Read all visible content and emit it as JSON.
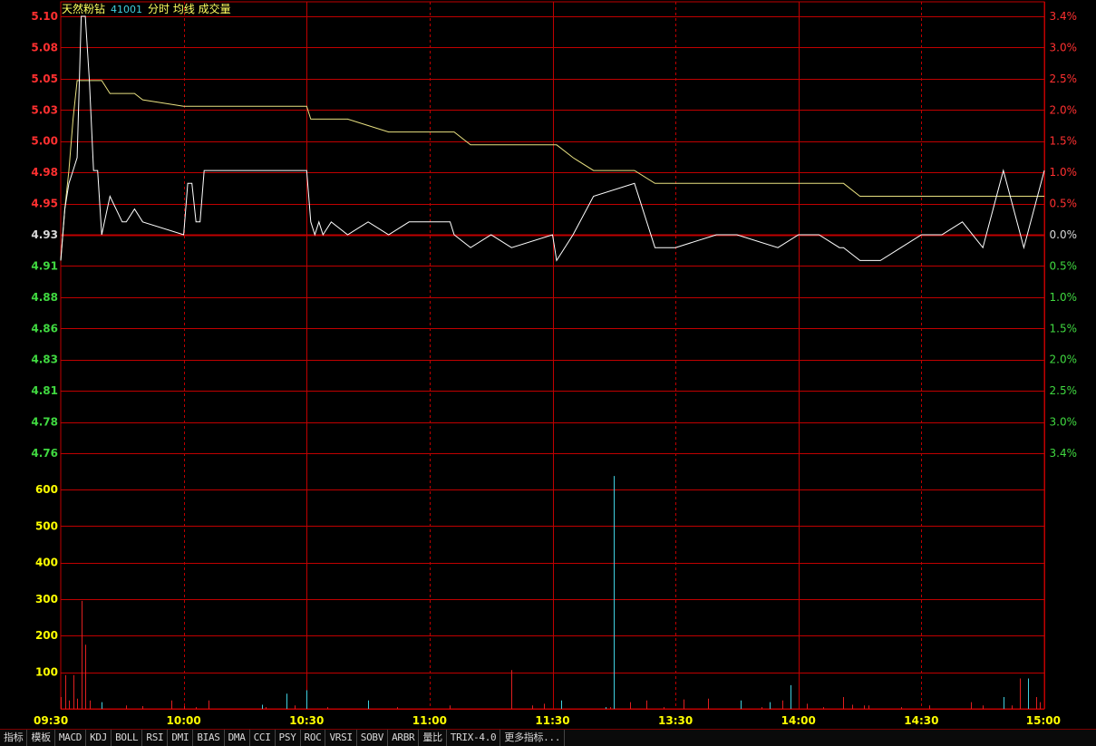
{
  "header": {
    "stock_name": "天然粉钻",
    "stock_code": "41001",
    "indicators": "分时 均线 成交量"
  },
  "colors": {
    "background": "#000000",
    "grid": "#c00000",
    "price_line": "#ffffff",
    "avg_line": "#e8e080",
    "up": "#ff3030",
    "down": "#40d840",
    "neutral_axis": "#ffff00",
    "volume_up": "#e02020",
    "volume_down": "#40d0e0"
  },
  "price_axis": {
    "labels": [
      "5.10",
      "5.08",
      "5.05",
      "5.03",
      "5.00",
      "4.98",
      "4.95",
      "4.93",
      "4.91",
      "4.88",
      "4.86",
      "4.83",
      "4.81",
      "4.78",
      "4.76"
    ],
    "ref_price": 4.93,
    "max": 5.1,
    "min": 4.76
  },
  "pct_axis": {
    "labels": [
      "3.4%",
      "3.0%",
      "2.5%",
      "2.0%",
      "1.5%",
      "1.0%",
      "0.5%",
      "0.0%",
      "0.5%",
      "1.0%",
      "1.5%",
      "2.0%",
      "2.5%",
      "3.0%",
      "3.4%"
    ]
  },
  "volume_axis": {
    "labels": [
      "600",
      "500",
      "400",
      "300",
      "200",
      "100"
    ],
    "max": 690
  },
  "time_axis": {
    "labels": [
      "09:30",
      "10:00",
      "10:30",
      "11:00",
      "11:30",
      "13:30",
      "14:00",
      "14:30",
      "15:00"
    ]
  },
  "chart_data": {
    "type": "line",
    "x": [
      0,
      1,
      2,
      3,
      4,
      5,
      6,
      7,
      8,
      9,
      10,
      12,
      15,
      16,
      18,
      20,
      30,
      31,
      32,
      33,
      34,
      35,
      60,
      61,
      62,
      63,
      64,
      66,
      70,
      75,
      80,
      85,
      95,
      96,
      100,
      105,
      110,
      120,
      121,
      125,
      130,
      140,
      145,
      150,
      160,
      165,
      175,
      180,
      185,
      190,
      191,
      195,
      200,
      205,
      210,
      215,
      220,
      225,
      230,
      235,
      240
    ],
    "series": [
      {
        "name": "分时",
        "values": [
          4.91,
          4.95,
          4.97,
          4.98,
          4.99,
          5.1,
          5.1,
          5.05,
          4.98,
          4.98,
          4.93,
          4.96,
          4.94,
          4.94,
          4.95,
          4.94,
          4.93,
          4.97,
          4.97,
          4.94,
          4.94,
          4.98,
          4.98,
          4.94,
          4.93,
          4.94,
          4.93,
          4.94,
          4.93,
          4.94,
          4.93,
          4.94,
          4.94,
          4.93,
          4.92,
          4.93,
          4.92,
          4.93,
          4.91,
          4.93,
          4.96,
          4.97,
          4.92,
          4.92,
          4.93,
          4.93,
          4.92,
          4.93,
          4.93,
          4.92,
          4.92,
          4.91,
          4.91,
          4.92,
          4.93,
          4.93,
          4.94,
          4.92,
          4.98,
          4.92,
          4.98
        ]
      },
      {
        "name": "均线",
        "values": [
          4.91,
          4.95,
          4.98,
          5.02,
          5.05,
          5.05,
          5.05,
          5.05,
          5.05,
          5.05,
          5.05,
          5.04,
          5.04,
          5.04,
          5.04,
          5.035,
          5.03,
          5.03,
          5.03,
          5.03,
          5.03,
          5.03,
          5.03,
          5.02,
          5.02,
          5.02,
          5.02,
          5.02,
          5.02,
          5.015,
          5.01,
          5.01,
          5.01,
          5.01,
          5.0,
          5.0,
          5.0,
          5.0,
          5.0,
          4.99,
          4.98,
          4.98,
          4.97,
          4.97,
          4.97,
          4.97,
          4.97,
          4.97,
          4.97,
          4.97,
          4.97,
          4.96,
          4.96,
          4.96,
          4.96,
          4.96,
          4.96,
          4.96,
          4.96,
          4.96,
          4.96
        ]
      }
    ],
    "volume": {
      "x": [
        0,
        1,
        2,
        3,
        4,
        5,
        6,
        7,
        10,
        16,
        20,
        27,
        30,
        33,
        36,
        49,
        50,
        55,
        57,
        60,
        65,
        75,
        82,
        95,
        110,
        115,
        118,
        122,
        133,
        134,
        135,
        139,
        143,
        147,
        152,
        158,
        166,
        171,
        173,
        176,
        178,
        182,
        186,
        191,
        193,
        196,
        197,
        205,
        212,
        222,
        225,
        230,
        232,
        234,
        236,
        238,
        239
      ],
      "values": [
        35,
        100,
        25,
        100,
        30,
        320,
        190,
        25,
        20,
        10,
        8,
        25,
        8,
        5,
        25,
        12,
        5,
        45,
        10,
        55,
        5,
        25,
        5,
        10,
        115,
        10,
        15,
        25,
        5,
        5,
        690,
        20,
        25,
        5,
        28,
        30,
        25,
        5,
        20,
        25,
        70,
        15,
        5,
        35,
        12,
        10,
        10,
        5,
        10,
        20,
        10,
        35,
        10,
        90,
        90,
        35,
        20
      ],
      "direction": [
        "u",
        "u",
        "u",
        "u",
        "u",
        "u",
        "u",
        "u",
        "d",
        "u",
        "u",
        "u",
        "u",
        "u",
        "u",
        "d",
        "u",
        "d",
        "u",
        "d",
        "u",
        "d",
        "u",
        "u",
        "u",
        "u",
        "u",
        "d",
        "d",
        "u",
        "d",
        "u",
        "u",
        "u",
        "u",
        "u",
        "d",
        "u",
        "d",
        "u",
        "d",
        "u",
        "u",
        "u",
        "u",
        "u",
        "u",
        "u",
        "u",
        "u",
        "u",
        "d",
        "u",
        "u",
        "d",
        "u",
        "u"
      ]
    },
    "title": "天然粉钻 41001",
    "xlabel": "",
    "ylabel": "",
    "ylim": [
      4.76,
      5.1
    ]
  },
  "tabs": [
    "指标",
    "模板",
    "MACD",
    "KDJ",
    "BOLL",
    "RSI",
    "DMI",
    "BIAS",
    "DMA",
    "CCI",
    "PSY",
    "ROC",
    "VRSI",
    "SOBV",
    "ARBR",
    "量比",
    "TRIX-4.0",
    "更多指标..."
  ]
}
